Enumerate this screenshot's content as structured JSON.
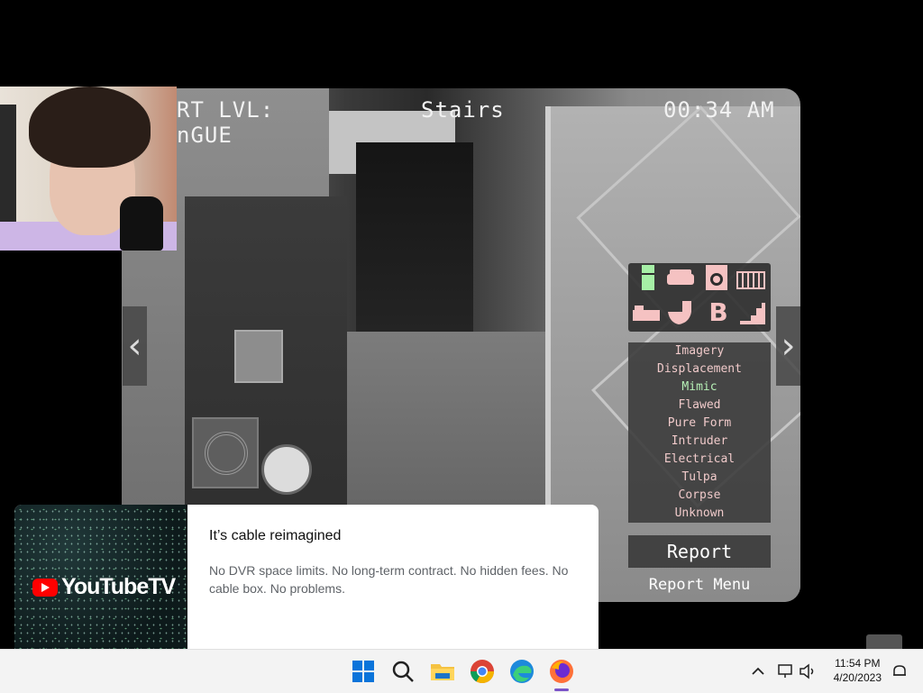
{
  "game": {
    "hud_left": "RT LVL:\nnGUE",
    "hud_left_line1": "RT LVL:",
    "hud_left_line2": "nGUE",
    "camera_name": "Stairs",
    "time": "00:34 AM",
    "nav_left_icon": "chevron-left-icon",
    "nav_right_icon": "chevron-right-icon",
    "icons": [
      {
        "name": "fridge-icon",
        "color": "#a6efa6"
      },
      {
        "name": "sofa-icon",
        "color": "#f5c2c2"
      },
      {
        "name": "washing-machine-icon",
        "color": "#f5c2c2"
      },
      {
        "name": "crib-icon",
        "color": "#f5c2c2"
      },
      {
        "name": "bed-icon",
        "color": "#f5c2c2"
      },
      {
        "name": "toilet-icon",
        "color": "#f5c2c2"
      },
      {
        "name": "letter-b-icon",
        "label": "B",
        "color": "#f5c2c2"
      },
      {
        "name": "stairs-icon",
        "color": "#f5c2c2"
      }
    ],
    "evidence": [
      {
        "label": "Imagery",
        "active": false
      },
      {
        "label": "Displacement",
        "active": false
      },
      {
        "label": "Mimic",
        "active": true
      },
      {
        "label": "Flawed",
        "active": false
      },
      {
        "label": "Pure Form",
        "active": false
      },
      {
        "label": "Intruder",
        "active": false
      },
      {
        "label": "Electrical",
        "active": false
      },
      {
        "label": "Tulpa",
        "active": false
      },
      {
        "label": "Corpse",
        "active": false
      },
      {
        "label": "Unknown",
        "active": false
      }
    ],
    "report_button": "Report",
    "report_menu": "Report Menu"
  },
  "ad": {
    "brand": "YouTubeTV",
    "title": "It’s cable reimagined",
    "body": "No DVR space limits. No long-term contract. No hidden fees. No cable box. No problems."
  },
  "taskbar": {
    "apps": [
      "windows-start-icon",
      "search-icon",
      "file-explorer-icon",
      "chrome-icon",
      "edge-icon",
      "firefox-icon"
    ],
    "time": "11:54 PM",
    "date": "4/20/2023"
  }
}
